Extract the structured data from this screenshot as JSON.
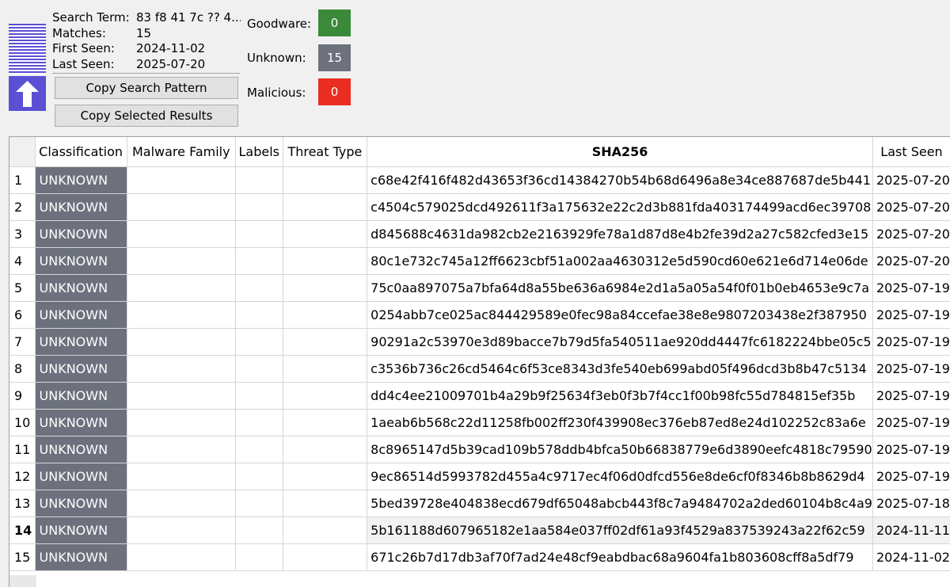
{
  "summary": {
    "search_term_label": "Search Term:",
    "search_term_value": "83 f8 41 7c ?? 4...",
    "matches_label": "Matches:",
    "matches_value": "15",
    "first_seen_label": "First Seen:",
    "first_seen_value": "2024-11-02",
    "last_seen_label": "Last Seen:",
    "last_seen_value": "2025-07-20"
  },
  "buttons": {
    "copy_pattern": "Copy Search Pattern",
    "copy_results": "Copy Selected Results"
  },
  "stats": {
    "goodware_label": "Goodware:",
    "goodware_value": "0",
    "unknown_label": "Unknown:",
    "unknown_value": "15",
    "malicious_label": "Malicious:",
    "malicious_value": "0"
  },
  "colors": {
    "accent": "#5b4fd4",
    "goodware": "#3a8a3a",
    "unknown": "#6d717d",
    "malicious": "#ea2d21"
  },
  "icons": {
    "logo": "up-arrow-icon"
  },
  "table": {
    "columns": [
      "Classification",
      "Malware Family",
      "Labels",
      "Threat Type",
      "SHA256",
      "Last Seen"
    ],
    "current_row": 14,
    "rows": [
      {
        "n": "1",
        "cls": "UNKNOWN",
        "family": "",
        "labels": "",
        "threat": "",
        "sha": "c68e42f416f482d43653f36cd14384270b54b68d6496a8e34ce887687de5b441",
        "last": "2025-07-20"
      },
      {
        "n": "2",
        "cls": "UNKNOWN",
        "family": "",
        "labels": "",
        "threat": "",
        "sha": "c4504c579025dcd492611f3a175632e22c2d3b881fda403174499acd6ec39708",
        "last": "2025-07-20"
      },
      {
        "n": "3",
        "cls": "UNKNOWN",
        "family": "",
        "labels": "",
        "threat": "",
        "sha": "d845688c4631da982cb2e2163929fe78a1d87d8e4b2fe39d2a27c582cfed3e15",
        "last": "2025-07-20"
      },
      {
        "n": "4",
        "cls": "UNKNOWN",
        "family": "",
        "labels": "",
        "threat": "",
        "sha": "80c1e732c745a12ff6623cbf51a002aa4630312e5d590cd60e621e6d714e06de",
        "last": "2025-07-20"
      },
      {
        "n": "5",
        "cls": "UNKNOWN",
        "family": "",
        "labels": "",
        "threat": "",
        "sha": "75c0aa897075a7bfa64d8a55be636a6984e2d1a5a05a54f0f01b0eb4653e9c7a",
        "last": "2025-07-19"
      },
      {
        "n": "6",
        "cls": "UNKNOWN",
        "family": "",
        "labels": "",
        "threat": "",
        "sha": "0254abb7ce025ac844429589e0fec98a84ccefae38e8e9807203438e2f387950",
        "last": "2025-07-19"
      },
      {
        "n": "7",
        "cls": "UNKNOWN",
        "family": "",
        "labels": "",
        "threat": "",
        "sha": "90291a2c53970e3d89bacce7b79d5fa540511ae920dd4447fc6182224bbe05c5",
        "last": "2025-07-19"
      },
      {
        "n": "8",
        "cls": "UNKNOWN",
        "family": "",
        "labels": "",
        "threat": "",
        "sha": "c3536b736c26cd5464c6f53ce8343d3fe540eb699abd05f496dcd3b8b47c5134",
        "last": "2025-07-19"
      },
      {
        "n": "9",
        "cls": "UNKNOWN",
        "family": "",
        "labels": "",
        "threat": "",
        "sha": "dd4c4ee21009701b4a29b9f25634f3eb0f3b7f4cc1f00b98fc55d784815ef35b",
        "last": "2025-07-19"
      },
      {
        "n": "10",
        "cls": "UNKNOWN",
        "family": "",
        "labels": "",
        "threat": "",
        "sha": "1aeab6b568c22d11258fb002ff230f439908ec376eb87ed8e24d102252c83a6e",
        "last": "2025-07-19"
      },
      {
        "n": "11",
        "cls": "UNKNOWN",
        "family": "",
        "labels": "",
        "threat": "",
        "sha": "8c8965147d5b39cad109b578ddb4bfca50b66838779e6d3890eefc4818c79590",
        "last": "2025-07-19"
      },
      {
        "n": "12",
        "cls": "UNKNOWN",
        "family": "",
        "labels": "",
        "threat": "",
        "sha": "9ec86514d5993782d455a4c9717ec4f06d0dfcd556e8de6cf0f8346b8b8629d4",
        "last": "2025-07-19"
      },
      {
        "n": "13",
        "cls": "UNKNOWN",
        "family": "",
        "labels": "",
        "threat": "",
        "sha": "5bed39728e404838ecd679df65048abcb443f8c7a9484702a2ded60104b8c4a9",
        "last": "2025-07-18"
      },
      {
        "n": "14",
        "cls": "UNKNOWN",
        "family": "",
        "labels": "",
        "threat": "",
        "sha": "5b161188d607965182e1aa584e037ff02df61a93f4529a837539243a22f62c59",
        "last": "2024-11-11"
      },
      {
        "n": "15",
        "cls": "UNKNOWN",
        "family": "",
        "labels": "",
        "threat": "",
        "sha": "671c26b7d17db3af70f7ad24e48cf9eabdbac68a9604fa1b803608cff8a5df79",
        "last": "2024-11-02"
      }
    ]
  }
}
